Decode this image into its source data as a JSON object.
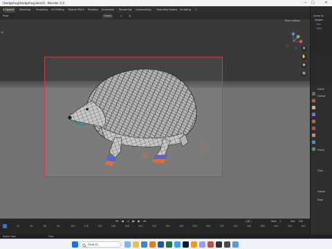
{
  "window": {
    "title": "[Hedgehog\\Hedgehog.blend] - Blender 4.0",
    "min_label": "—",
    "max_label": "□",
    "close_label": "✕"
  },
  "menu": {
    "tabs": [
      "Layout",
      "Modeling",
      "Sculpting",
      "UV Editing",
      "Texture Paint",
      "Shading",
      "Animation",
      "Rendering",
      "Compositing",
      "Geometry Nodes",
      "Scripting"
    ],
    "add_tab": "+",
    "scene_label": "Scene"
  },
  "header": {
    "mode": "Pixel",
    "transform": "Global",
    "viewport_label": "x",
    "pixel_options": "Pixel Options"
  },
  "gizmo": {
    "z": "Z",
    "y": "Y",
    "x": "X"
  },
  "outliner": {
    "items": [
      "Scene Co",
      "Hedgeh",
      "Cam",
      "Light"
    ]
  },
  "props": {
    "labels": [
      "Scene",
      "Format",
      "Frame",
      "Time",
      "Output",
      "Drpg"
    ]
  },
  "timeline": {
    "frame_current": "0",
    "ticks": [
      "0",
      "20",
      "40",
      "60",
      "80",
      "100",
      "120",
      "140",
      "160",
      "180",
      "200",
      "220",
      "240",
      "260",
      "280",
      "300",
      "320",
      "340",
      "360",
      "380",
      "400",
      "420",
      "440"
    ],
    "start_label": "Start",
    "start_value": "1",
    "end_label": "End",
    "end_value": "250"
  },
  "status": {
    "left": "Rotate View",
    "mid": "Pixel"
  },
  "taskbar": {
    "search": "Search",
    "colors": {
      "win": "#1a73e8",
      "blender": "#e87d0d",
      "word": "#2b579a",
      "excel": "#217346",
      "ps": "#31a8ff",
      "ai": "#ff9a00",
      "pr": "#9999ff",
      "ae": "#9999ff"
    }
  },
  "colors": {
    "accent": "#e87d0d",
    "camera_frame": "#c04050",
    "floor": "#737373",
    "viewport_bg": "#393939"
  }
}
